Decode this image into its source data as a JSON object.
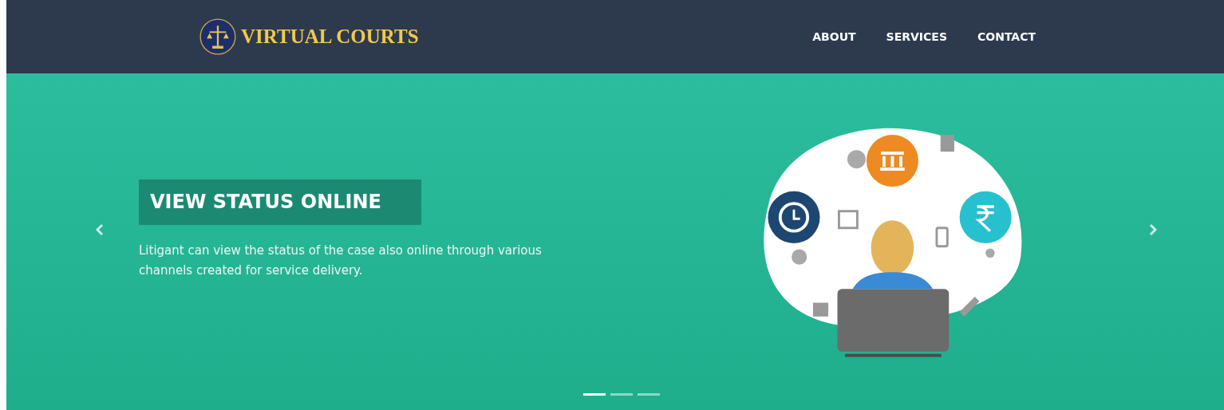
{
  "header": {
    "logo_text": "VIRTUAL COURTS",
    "nav": [
      {
        "label": "ABOUT"
      },
      {
        "label": "SERVICES"
      },
      {
        "label": "CONTACT"
      }
    ]
  },
  "slide": {
    "title": "VIEW STATUS ONLINE",
    "text": "Litigant can view the status of the case also online through various channels created for service delivery."
  },
  "indicators": [
    {
      "selected": true
    },
    {
      "selected": false
    },
    {
      "selected": false
    }
  ]
}
